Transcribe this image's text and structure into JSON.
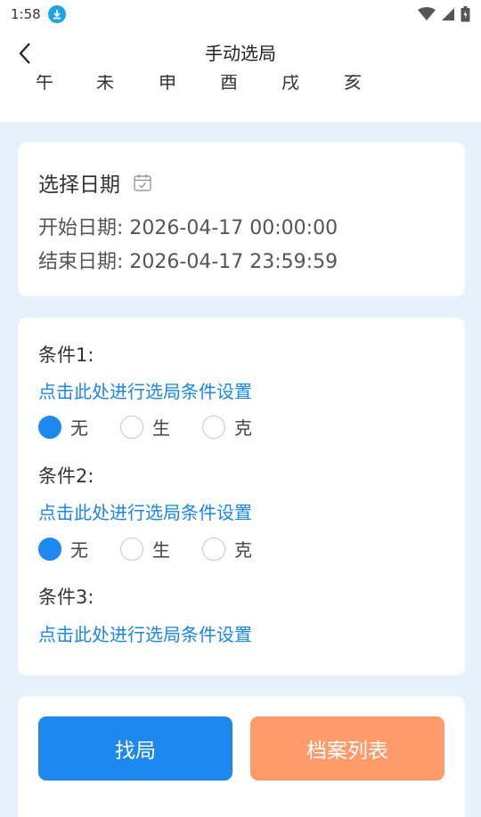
{
  "status": {
    "time": "1:58"
  },
  "header": {
    "title": "手动选局",
    "ganzhi": [
      "午",
      "未",
      "申",
      "酉",
      "戌",
      "亥"
    ]
  },
  "date_card": {
    "title": "选择日期",
    "start_label": "开始日期:",
    "start_value": "2026-04-17 00:00:00",
    "end_label": "结束日期:",
    "end_value": "2026-04-17 23:59:59"
  },
  "conditions": [
    {
      "label": "条件1:",
      "link": "点击此处进行选局条件设置",
      "options": [
        "无",
        "生",
        "克"
      ],
      "selected": 0
    },
    {
      "label": "条件2:",
      "link": "点击此处进行选局条件设置",
      "options": [
        "无",
        "生",
        "克"
      ],
      "selected": 0
    },
    {
      "label": "条件3:",
      "link": "点击此处进行选局条件设置"
    }
  ],
  "buttons": {
    "find": "找局",
    "archive": "档案列表"
  },
  "colors": {
    "primary": "#1e87f0",
    "accent": "#ff9a6a",
    "link": "#1a86e8",
    "background": "#e6f2fb"
  }
}
